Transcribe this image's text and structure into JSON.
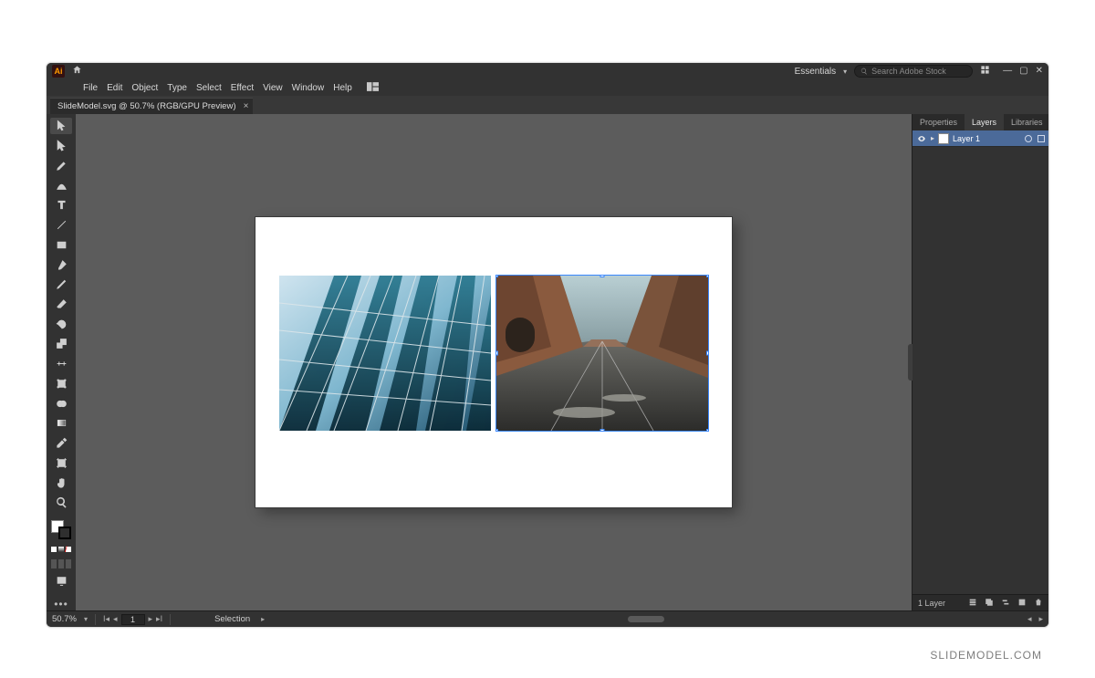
{
  "app": {
    "logo_text": "Ai",
    "workspace": "Essentials",
    "search_placeholder": "Search Adobe Stock"
  },
  "menubar": {
    "items": [
      "File",
      "Edit",
      "Object",
      "Type",
      "Select",
      "Effect",
      "View",
      "Window",
      "Help"
    ]
  },
  "document": {
    "tab_title": "SlideModel.svg @ 50.7% (RGB/GPU Preview)"
  },
  "panels": {
    "tabs": [
      "Properties",
      "Layers",
      "Libraries"
    ],
    "active_tab": "Layers",
    "layer_name": "Layer 1",
    "footer_count": "1 Layer"
  },
  "statusbar": {
    "zoom": "50.7%",
    "artboard_page": "1",
    "tool_label": "Selection"
  },
  "watermark": "SLIDEMODEL.COM",
  "tools": [
    "selection",
    "direct-selection",
    "pen",
    "curvature",
    "type",
    "line",
    "rectangle",
    "paintbrush",
    "pencil",
    "eraser",
    "rotate",
    "scale",
    "width",
    "free-transform",
    "shape-builder",
    "gradient",
    "eyedropper",
    "blend",
    "symbol-sprayer",
    "artboard",
    "slice",
    "hand",
    "zoom"
  ]
}
